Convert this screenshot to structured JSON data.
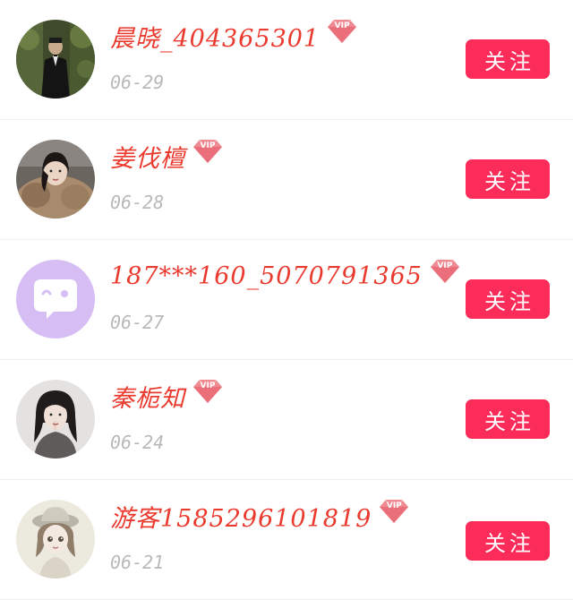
{
  "follow_list": [
    {
      "name": "晨晓_404365301",
      "date": "06-29",
      "vip_badge": "VIP",
      "follow_label": "关注",
      "avatar_icon": "photo-man-in-suit"
    },
    {
      "name": "姜伐檀",
      "date": "06-28",
      "vip_badge": "VIP",
      "follow_label": "关注",
      "avatar_icon": "photo-woman-in-fur"
    },
    {
      "name": "187***160_5070791365",
      "date": "06-27",
      "vip_badge": "VIP",
      "follow_label": "关注",
      "avatar_icon": "default-chat-bubble-avatar"
    },
    {
      "name": "秦栀知",
      "date": "06-24",
      "vip_badge": "VIP",
      "follow_label": "关注",
      "avatar_icon": "photo-girl"
    },
    {
      "name": "游客1585296101819",
      "date": "06-21",
      "vip_badge": "VIP",
      "follow_label": "关注",
      "avatar_icon": "sketch-girl-with-hat"
    }
  ],
  "colors": {
    "name": "#ea3a2e",
    "date": "#b9b9b9",
    "follow_button": "#fb2b5a",
    "vip_badge": "#f08a92",
    "default_avatar": "#d6bdf4"
  }
}
